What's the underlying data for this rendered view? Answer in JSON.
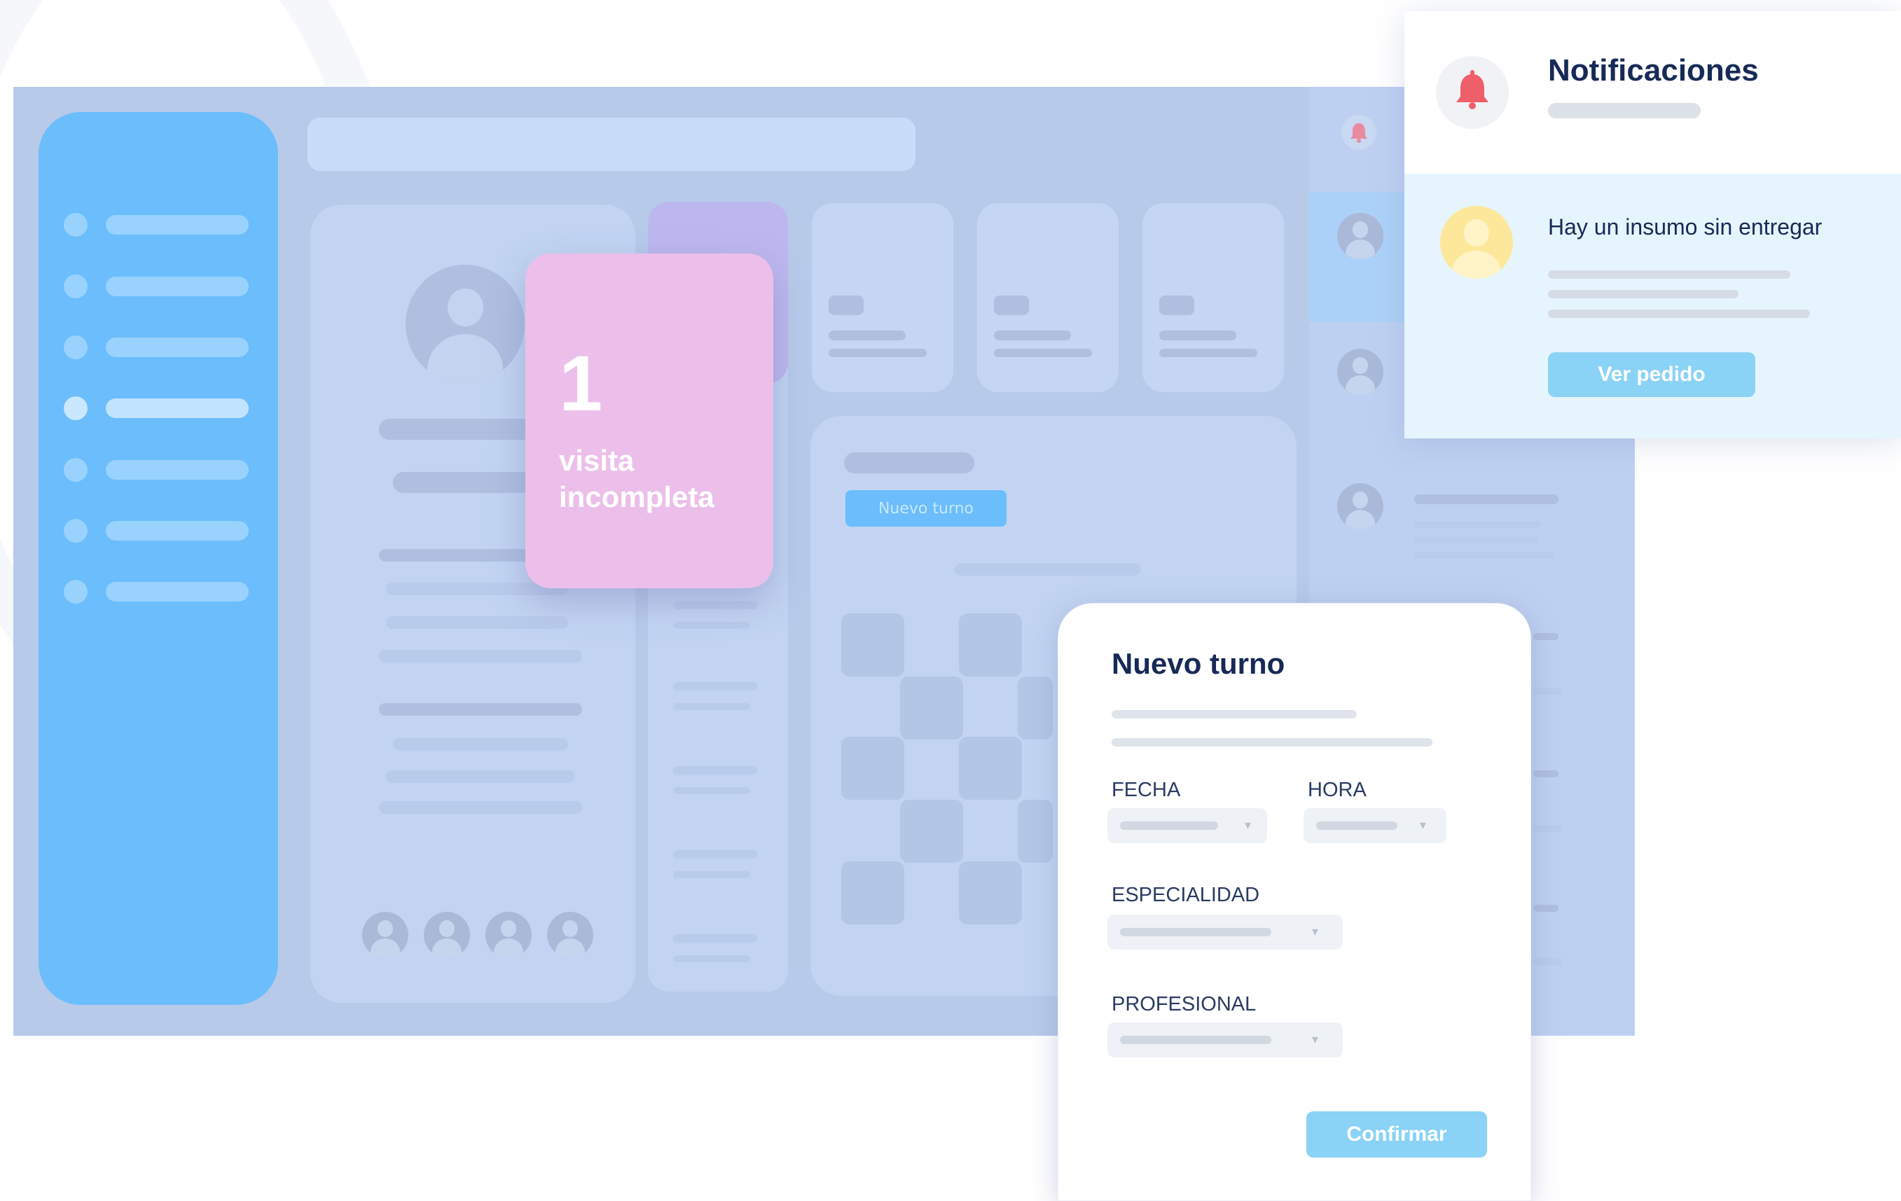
{
  "pink_card": {
    "number": "1",
    "text_line1": "visita",
    "text_line2": "incompleta"
  },
  "dashboard": {
    "nuevo_turno_button": "Nuevo turno"
  },
  "notifications": {
    "title": "Notificaciones",
    "message": "Hay un insumo sin entregar",
    "button": "Ver pedido"
  },
  "modal": {
    "title": "Nuevo turno",
    "fecha_label": "FECHA",
    "hora_label": "HORA",
    "especialidad_label": "ESPECIALIDAD",
    "profesional_label": "PROFESIONAL",
    "confirm_button": "Confirmar"
  },
  "icons": {
    "bell": "bell-icon",
    "avatar": "user-avatar-icon",
    "caret": "chevron-down-icon"
  },
  "colors": {
    "sidebar": "#6bbdfc",
    "dashboard_bg": "#b7caea",
    "pink_card": "#ebbfea",
    "accent_button": "#8ad3f6",
    "notif_highlight": "#e6f5fd",
    "bell": "#ef5f6a",
    "title_text": "#172a57"
  }
}
